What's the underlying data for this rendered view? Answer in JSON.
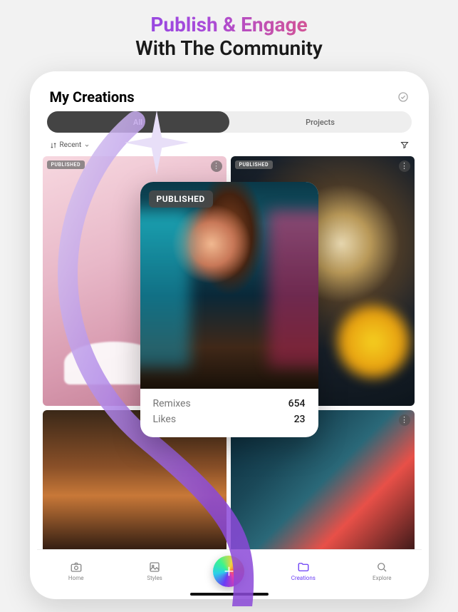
{
  "hero": {
    "line1": "Publish & Engage",
    "line2": "With The Community"
  },
  "header": {
    "title": "My Creations"
  },
  "tabs": {
    "items": [
      {
        "label": "All",
        "active": true
      },
      {
        "label": "Projects",
        "active": false
      }
    ]
  },
  "sort": {
    "label": "Recent"
  },
  "thumbs": [
    {
      "badge": "PUBLISHED"
    },
    {
      "badge": "PUBLISHED"
    }
  ],
  "card": {
    "badge": "PUBLISHED",
    "stats": {
      "remixes_label": "Remixes",
      "remixes_value": "654",
      "likes_label": "Likes",
      "likes_value": "23"
    }
  },
  "toolbar": {
    "home": "Home",
    "styles": "Styles",
    "creations": "Creations",
    "explore": "Explore"
  }
}
